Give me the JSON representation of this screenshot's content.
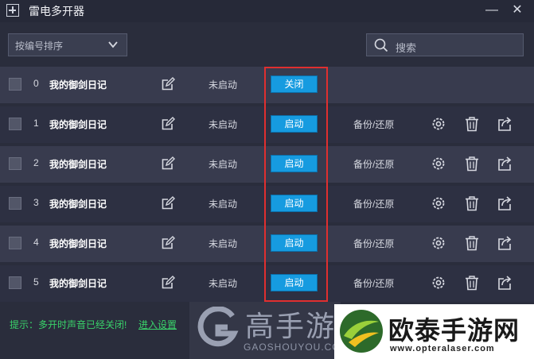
{
  "window": {
    "title": "雷电多开器",
    "minimize_glyph": "—",
    "close_glyph": "✕"
  },
  "toolbar": {
    "sort_label": "按编号排序",
    "search_placeholder": "搜索"
  },
  "rows": [
    {
      "index": "0",
      "name": "我的御剑日记",
      "status": "未启动",
      "action": "关闭",
      "backup": ""
    },
    {
      "index": "1",
      "name": "我的御剑日记",
      "status": "未启动",
      "action": "启动",
      "backup": "备份/还原"
    },
    {
      "index": "2",
      "name": "我的御剑日记",
      "status": "未启动",
      "action": "启动",
      "backup": "备份/还原"
    },
    {
      "index": "3",
      "name": "我的御剑日记",
      "status": "未启动",
      "action": "启动",
      "backup": "备份/还原"
    },
    {
      "index": "4",
      "name": "我的御剑日记",
      "status": "未启动",
      "action": "启动",
      "backup": "备份/还原"
    },
    {
      "index": "5",
      "name": "我的御剑日记",
      "status": "未启动",
      "action": "启动",
      "backup": "备份/还原"
    }
  ],
  "footer": {
    "tip": "提示：多开时声音已经关闭!",
    "link": "进入设置"
  },
  "watermarks": {
    "gaoshou_name": "高手游",
    "gaoshou_url": "GAOSHOUYOU.COM",
    "opte_name": "欧泰手游网",
    "opte_url": "www.opteralaser.com"
  },
  "colors": {
    "accent": "#169be0",
    "highlight": "#e02f2f",
    "tip": "#39d26a"
  }
}
